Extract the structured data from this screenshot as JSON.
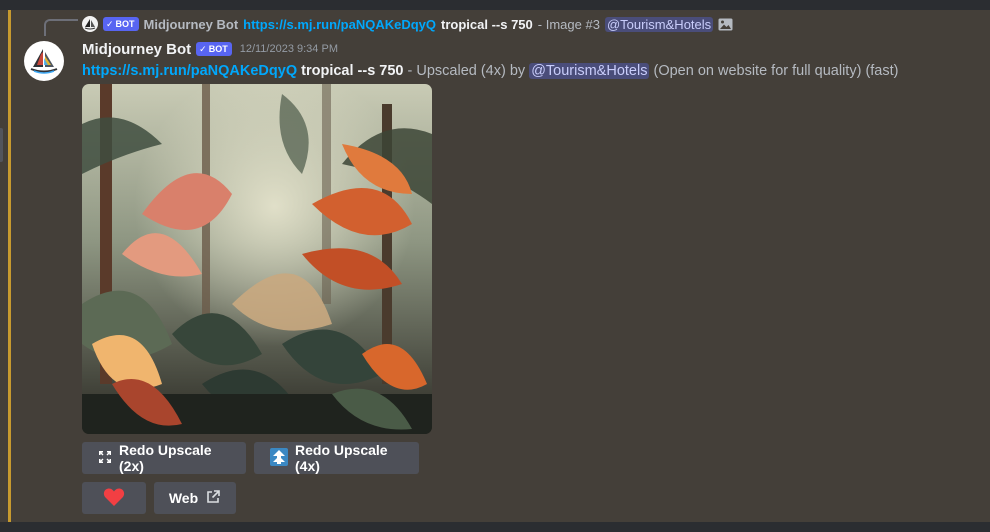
{
  "reply": {
    "bot_tag": "BOT",
    "author": "Midjourney Bot",
    "link": "https://s.mj.run/paNQAKeDqyQ",
    "prompt": "tropical --s 750",
    "suffix": "- Image #3",
    "mention": "@Tourism&Hotels"
  },
  "message": {
    "author": "Midjourney Bot",
    "bot_tag": "BOT",
    "timestamp": "12/11/2023 9:34 PM",
    "link": "https://s.mj.run/paNQAKeDqyQ",
    "prompt": "tropical --s 750",
    "dash_text": "- Upscaled (4x) by",
    "mention": "@Tourism&Hotels",
    "tail": "(Open on website for full quality) (fast)"
  },
  "buttons": {
    "redo_2x": "Redo Upscale (2x)",
    "redo_4x": "Redo Upscale (4x)",
    "web": "Web"
  },
  "icons": {
    "verified": "checkmark-icon",
    "attachment": "image-icon",
    "expand": "expand-arrows-icon",
    "upscale": "upscale-arrow-icon",
    "reaction": "heart-icon",
    "external": "external-link-icon"
  },
  "colors": {
    "link": "#00a8fc",
    "bot_tag": "#5865f2",
    "accent_bar": "#c79a2f",
    "heart": "#f23f43",
    "button": "#4e5058"
  }
}
